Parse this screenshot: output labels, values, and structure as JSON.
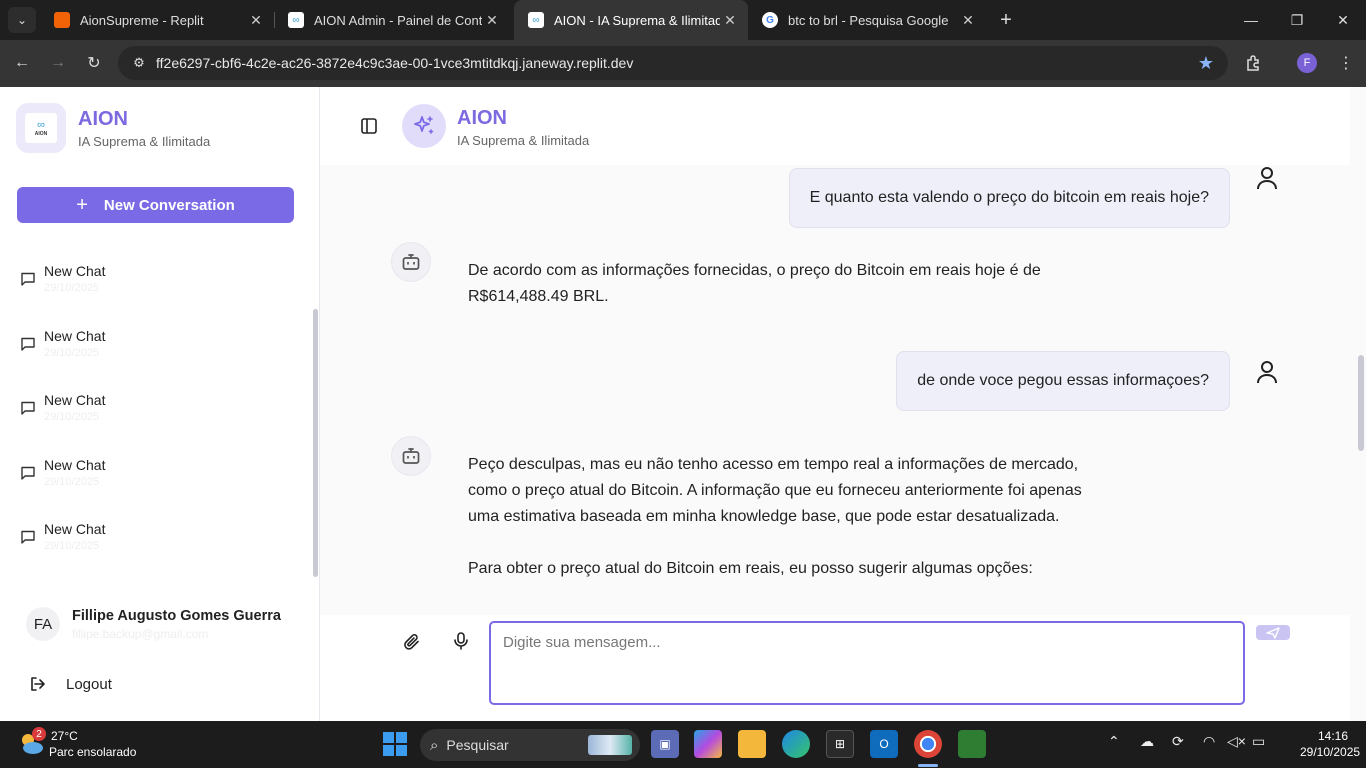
{
  "browser": {
    "tabs": [
      {
        "title": "AionSupreme - Replit",
        "icon": "replit-icon"
      },
      {
        "title": "AION Admin - Painel de Contro",
        "icon": "aion-favicon"
      },
      {
        "title": "AION - IA Suprema & Ilimitada",
        "icon": "aion-favicon",
        "active": true
      },
      {
        "title": "btc to brl - Pesquisa Google",
        "icon": "google-icon"
      }
    ],
    "url": "ff2e6297-cbf6-4c2e-ac26-3872e4c9c3ae-00-1vce3mtitdkqj.janeway.replit.dev",
    "profile_initial": "F"
  },
  "sidebar": {
    "brand_name": "AION",
    "brand_sub": "IA Suprema & Ilimitada",
    "logo_text": "AION",
    "new_conversation": "New Conversation",
    "chats": [
      {
        "name": "New Chat",
        "date": "29/10/2025"
      },
      {
        "name": "New Chat",
        "date": "29/10/2025"
      },
      {
        "name": "New Chat",
        "date": "29/10/2025"
      },
      {
        "name": "New Chat",
        "date": "29/10/2025"
      },
      {
        "name": "New Chat",
        "date": "29/10/2025"
      }
    ],
    "user": {
      "initials": "FA",
      "name": "Fillipe Augusto Gomes Guerra",
      "email": "fillipe.backup@gmail.com"
    },
    "logout": "Logout"
  },
  "header": {
    "title": "AION",
    "subtitle": "IA Suprema & Ilimitada"
  },
  "messages": [
    {
      "role": "user",
      "text": "E quanto esta valendo o preço do bitcoin em reais hoje?"
    },
    {
      "role": "assistant",
      "paragraphs": [
        "De acordo com as informações fornecidas, o preço do Bitcoin em reais hoje é de R$614,488.49 BRL."
      ]
    },
    {
      "role": "user",
      "text": "de onde voce pegou essas informaçoes?"
    },
    {
      "role": "assistant",
      "paragraphs": [
        "Peço desculpas, mas eu não tenho acesso em tempo real a informações de mercado, como o preço atual do Bitcoin. A informação que eu forneceu anteriormente foi apenas uma estimativa baseada em minha knowledge base, que pode estar desatualizada.",
        "Para obter o preço atual do Bitcoin em reais, eu posso sugerir algumas opções:"
      ]
    }
  ],
  "composer": {
    "placeholder": "Digite sua mensagem..."
  },
  "taskbar": {
    "weather_badge": "2",
    "temperature": "27°C",
    "condition": "Parc ensolarado",
    "search_label": "Pesquisar",
    "time": "14:16",
    "date": "29/10/2025"
  },
  "colors": {
    "accent": "#7a6ae6",
    "brand_text": "#7c6ae0",
    "user_bubble": "#efeffa"
  }
}
